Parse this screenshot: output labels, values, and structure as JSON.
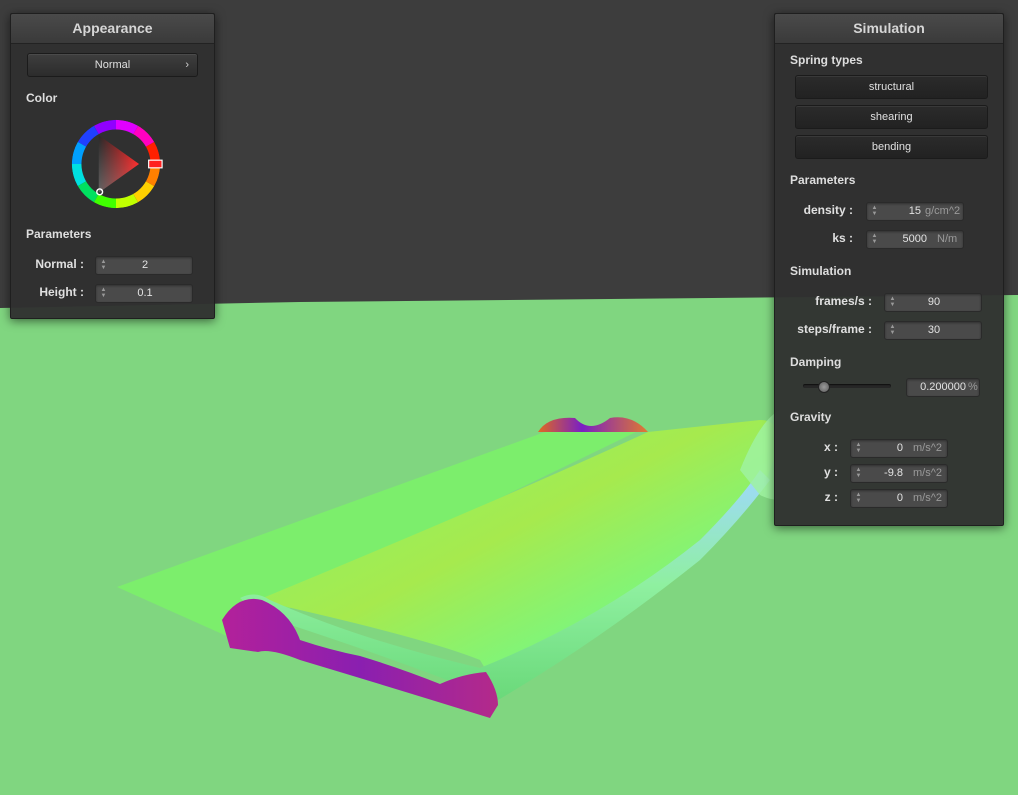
{
  "appearance": {
    "title": "Appearance",
    "shader_dropdown": "Normal",
    "color_label": "Color",
    "parameters_label": "Parameters",
    "normal_label": "Normal :",
    "normal_value": "2",
    "height_label": "Height :",
    "height_value": "0.1"
  },
  "simulation": {
    "title": "Simulation",
    "spring_types_label": "Spring types",
    "spring_buttons": [
      "structural",
      "shearing",
      "bending"
    ],
    "parameters_label": "Parameters",
    "density_label": "density :",
    "density_value": "15",
    "density_unit": "g/cm^2",
    "ks_label": "ks :",
    "ks_value": "5000",
    "ks_unit": "N/m",
    "simulation_label": "Simulation",
    "fps_label": "frames/s :",
    "fps_value": "90",
    "steps_label": "steps/frame :",
    "steps_value": "30",
    "damping_label": "Damping",
    "damping_value": "0.200000",
    "damping_unit": "%",
    "damping_fraction": 0.2,
    "gravity_label": "Gravity",
    "gx_label": "x :",
    "gx_value": "0",
    "gy_label": "y :",
    "gy_value": "-9.8",
    "gz_label": "z :",
    "gz_value": "0",
    "gravity_unit": "m/s^2"
  },
  "colors": {
    "floor": "#80d680",
    "background": "#3d3d3d",
    "cloth_green": "#7cf06a",
    "cloth_edge": "#8a1fb0"
  },
  "icons": {
    "dropdown_arrow": "chevron-right-icon",
    "spinner": "spinner-arrows-icon"
  }
}
